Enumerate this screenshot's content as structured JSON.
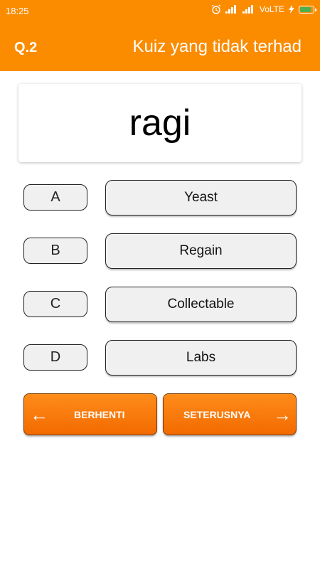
{
  "status_bar": {
    "time": "18:25",
    "network": "VoLTE",
    "alarm_icon": "alarm-clock-icon",
    "battery_color": "#4caf50"
  },
  "header": {
    "question_number": "Q.2",
    "title": "Kuiz yang tidak terhad",
    "background_color": "#fb8c00"
  },
  "question": {
    "word": "ragi"
  },
  "options": [
    {
      "letter": "A",
      "answer": "Yeast"
    },
    {
      "letter": "B",
      "answer": "Regain"
    },
    {
      "letter": "C",
      "answer": "Collectable"
    },
    {
      "letter": "D",
      "answer": "Labs"
    }
  ],
  "buttons": {
    "stop_label": "BERHENTI",
    "next_label": "SETERUSNYA",
    "stop_icon": "arrow-left-icon",
    "next_icon": "arrow-right-icon"
  }
}
